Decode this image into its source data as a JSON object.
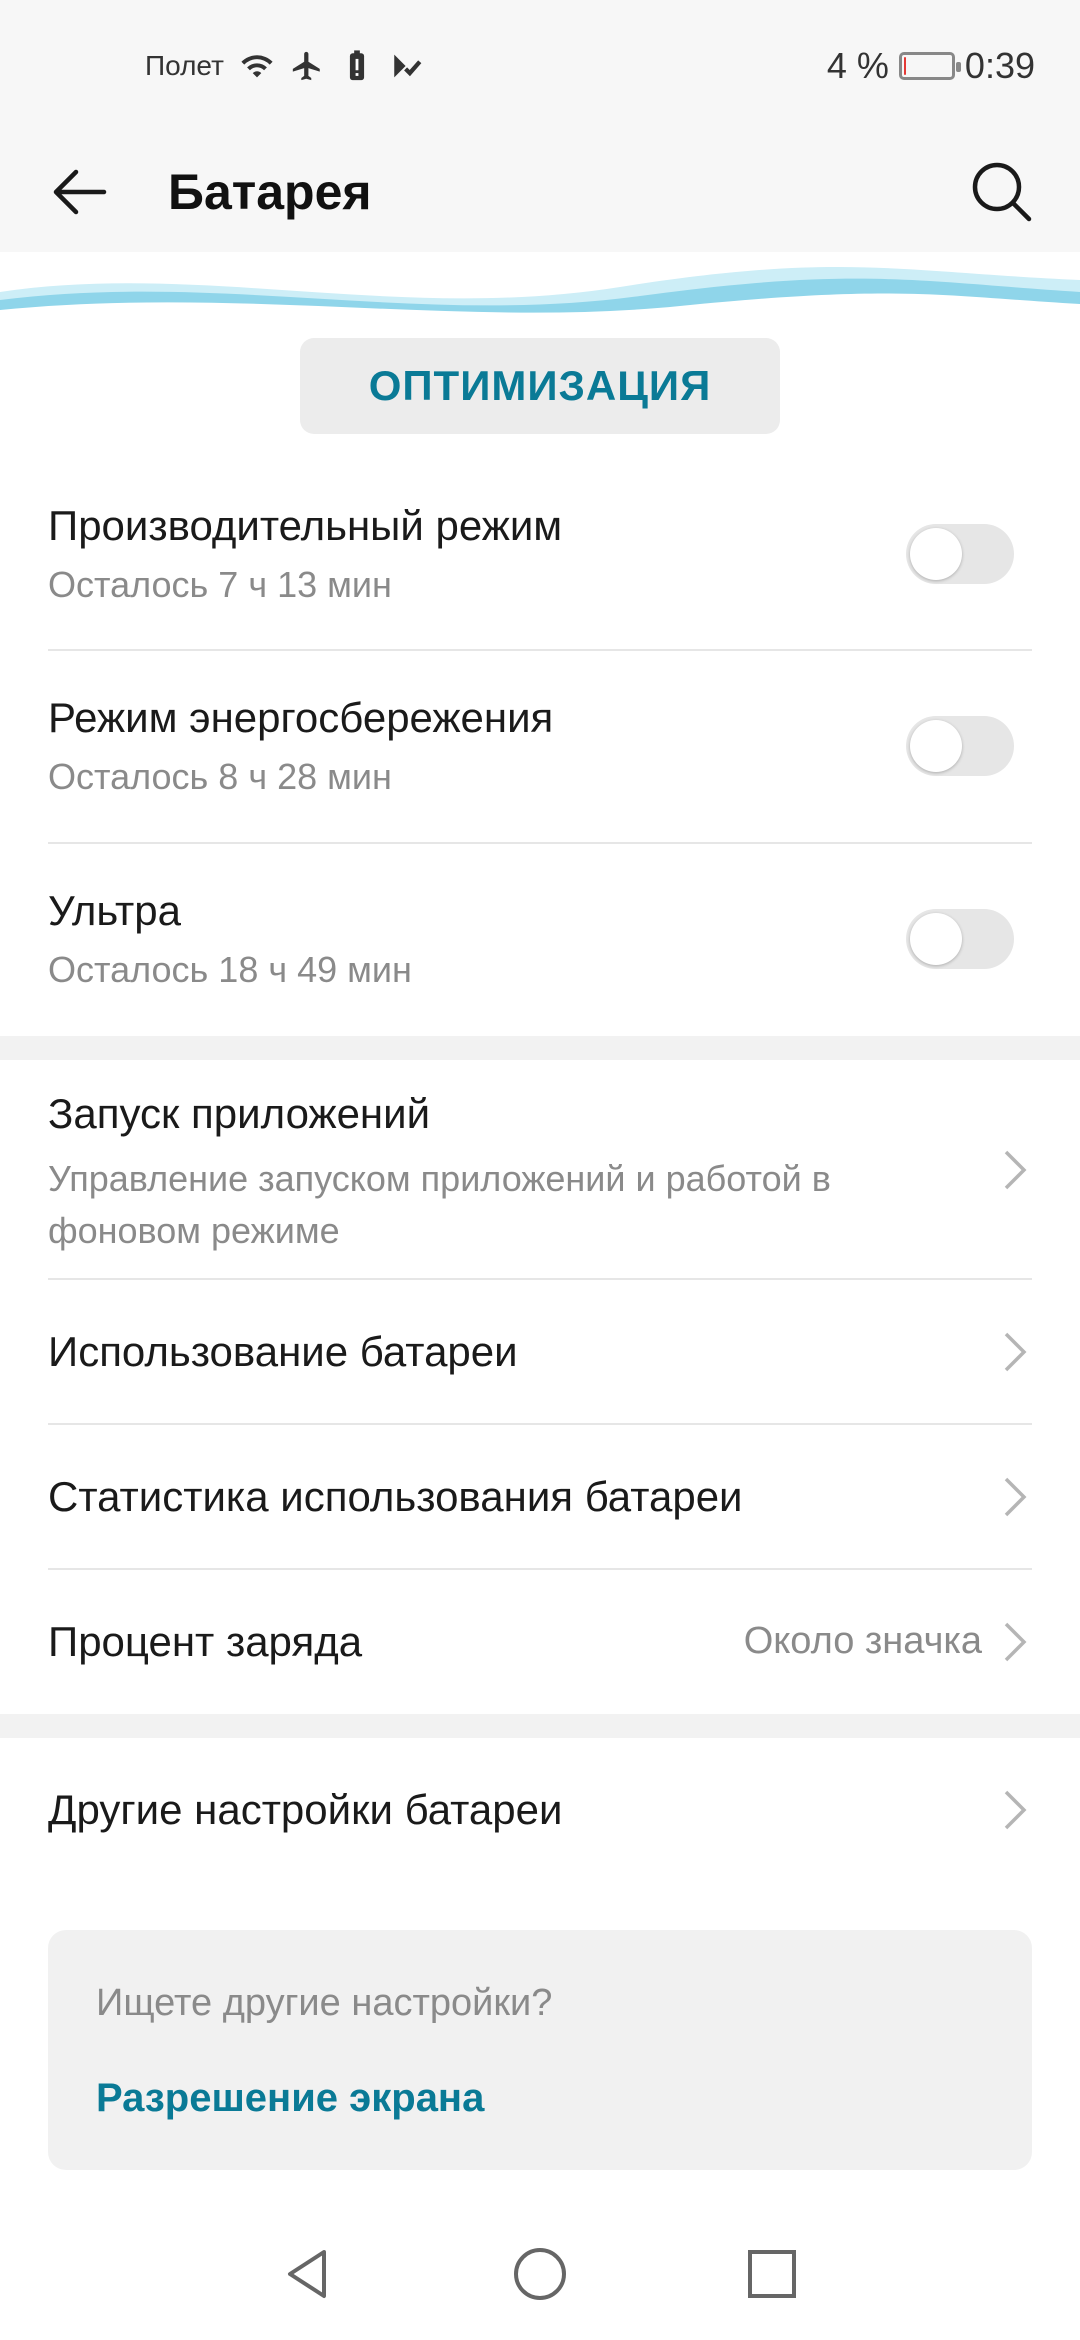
{
  "status_bar": {
    "carrier": "Полет",
    "battery_percent": "4 %",
    "battery_level": 0.04,
    "time": "0:39",
    "icons": [
      "wifi-icon",
      "airplane-icon",
      "battery-alert-icon",
      "signal-check-icon"
    ]
  },
  "app_bar": {
    "title": "Батарея"
  },
  "optimize_button": "ОПТИМИЗАЦИЯ",
  "modes": [
    {
      "title": "Производительный режим",
      "subtitle": "Осталось 7 ч 13 мин",
      "enabled": false
    },
    {
      "title": "Режим энергосбережения",
      "subtitle": "Осталось 8 ч 28 мин",
      "enabled": false
    },
    {
      "title": "Ультра",
      "subtitle": "Осталось 18 ч 49 мин",
      "enabled": false
    }
  ],
  "settings": [
    {
      "title": "Запуск приложений",
      "subtitle_line1": "Управление запуском приложений и работой в",
      "subtitle_line2": "фоновом режиме"
    },
    {
      "title": "Использование батареи"
    },
    {
      "title": "Статистика использования батареи"
    },
    {
      "title": "Процент заряда",
      "value": "Около значка"
    }
  ],
  "other_settings": "Другие настройки батареи",
  "suggestion": {
    "question": "Ищете другие настройки?",
    "link": "Разрешение экрана"
  },
  "colors": {
    "accent": "#0a7a96",
    "battery_low": "#e53935"
  }
}
